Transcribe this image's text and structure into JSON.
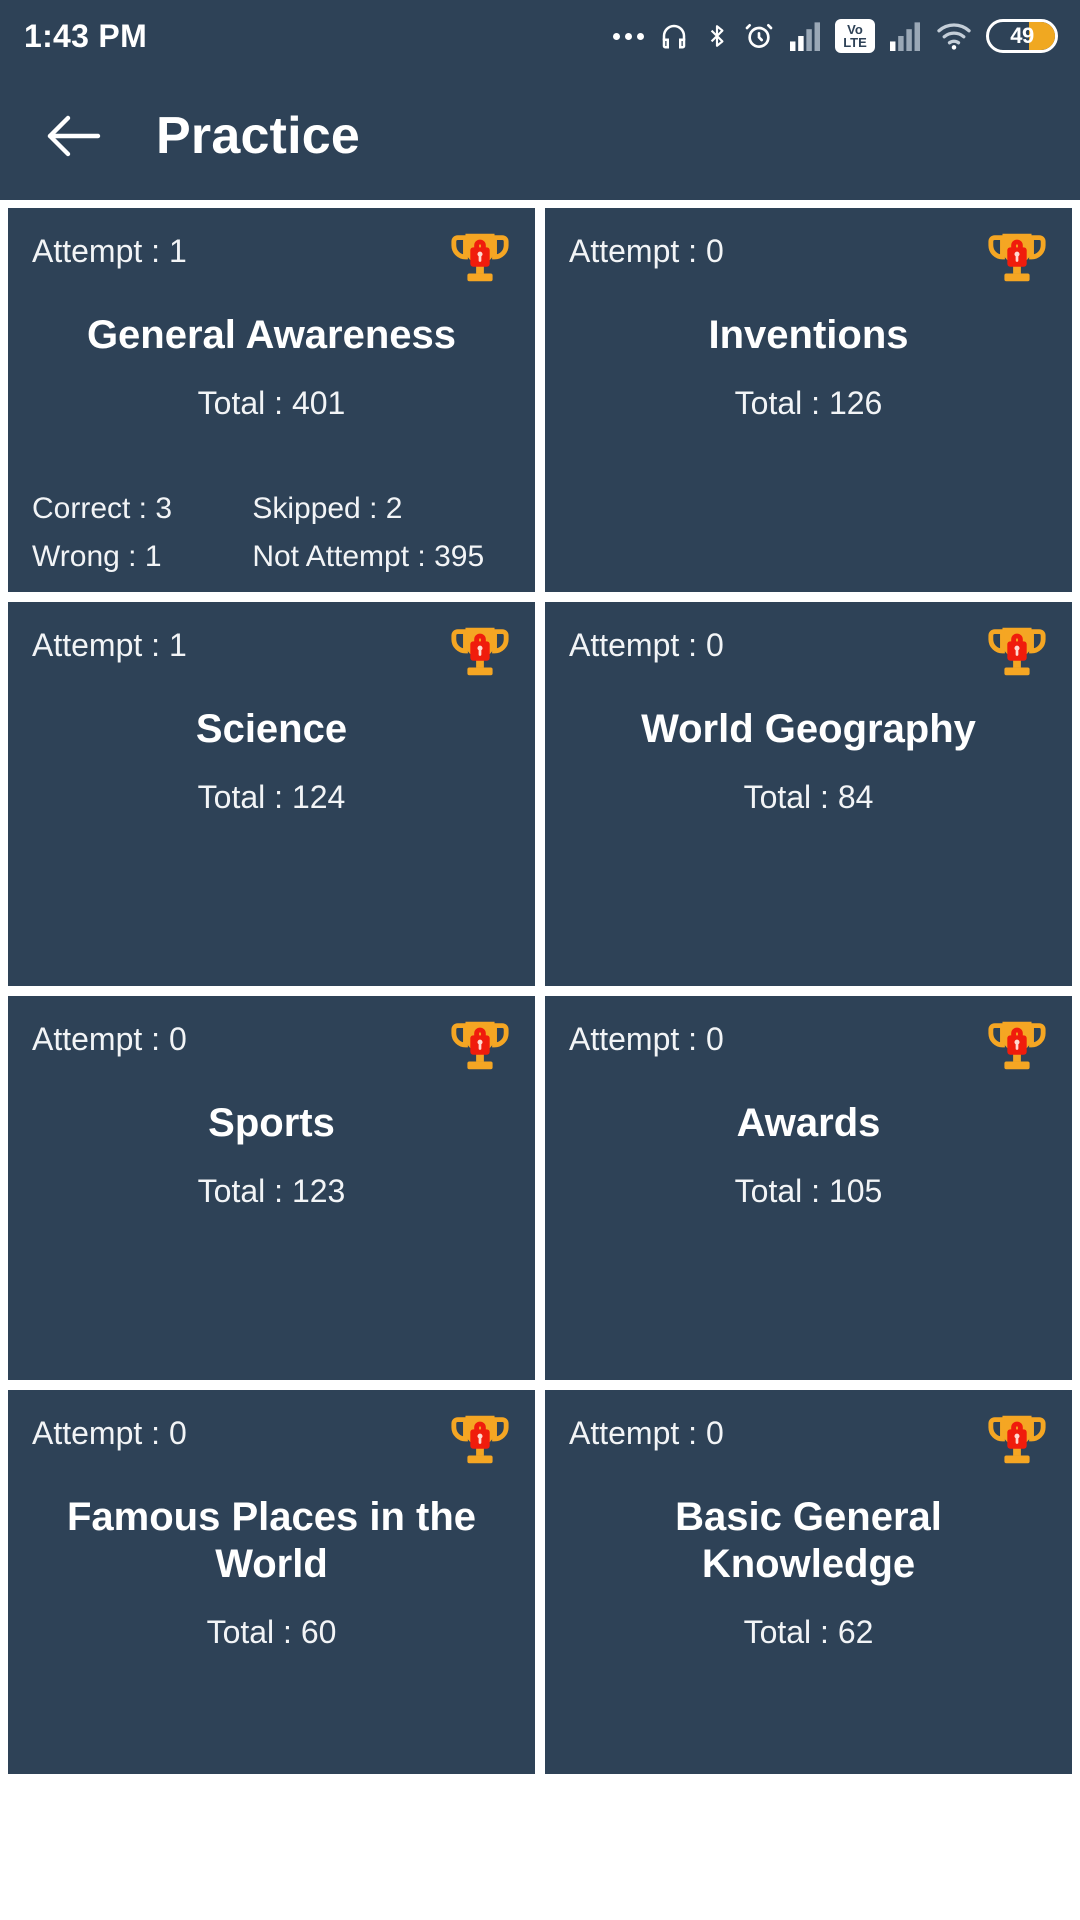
{
  "theme": {
    "surface": "#2e4257",
    "page_bg": "#ffffff",
    "text": "#ffffff",
    "trophy_gold": "#f5a623",
    "lock_red": "#f01c0c",
    "battery_amber": "#f0a821"
  },
  "status_bar": {
    "time": "1:43 PM",
    "battery_level": "49",
    "volte_top": "Vo",
    "volte_bottom": "LTE",
    "icons": [
      "more-dots-icon",
      "headphones-icon",
      "bluetooth-icon",
      "alarm-icon",
      "signal-bars-icon",
      "volte-icon",
      "signal-bars-2-icon",
      "wifi-icon",
      "battery-icon"
    ]
  },
  "appbar": {
    "back_icon": "back-arrow-icon",
    "title": "Practice"
  },
  "cards": [
    {
      "attempt": "Attempt : 1",
      "title": "General Awareness",
      "total": "Total : 401",
      "correct": "Correct : 3",
      "skipped": "Skipped : 2",
      "wrong": "Wrong : 1",
      "not_attempt": "Not Attempt : 395",
      "badge": "locked-trophy-icon"
    },
    {
      "attempt": "Attempt : 0",
      "title": "Inventions",
      "total": "Total : 126",
      "badge": "locked-trophy-icon"
    },
    {
      "attempt": "Attempt : 1",
      "title": "Science",
      "total": "Total : 124",
      "badge": "locked-trophy-icon"
    },
    {
      "attempt": "Attempt : 0",
      "title": "World Geography",
      "total": "Total : 84",
      "badge": "locked-trophy-icon"
    },
    {
      "attempt": "Attempt : 0",
      "title": "Sports",
      "total": "Total : 123",
      "badge": "locked-trophy-icon"
    },
    {
      "attempt": "Attempt : 0",
      "title": "Awards",
      "total": "Total : 105",
      "badge": "locked-trophy-icon"
    },
    {
      "attempt": "Attempt : 0",
      "title": "Famous Places in the World",
      "total": "Total : 60",
      "badge": "locked-trophy-icon"
    },
    {
      "attempt": "Attempt : 0",
      "title": "Basic General Knowledge",
      "total": "Total : 62",
      "badge": "locked-trophy-icon"
    }
  ]
}
